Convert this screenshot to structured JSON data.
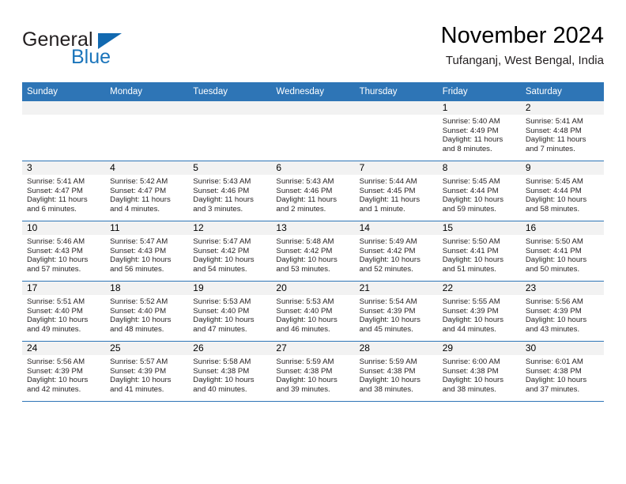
{
  "brand": {
    "name_part1": "General",
    "name_part2": "Blue"
  },
  "header": {
    "title": "November 2024",
    "subtitle": "Tufanganj, West Bengal, India"
  },
  "colors": {
    "header_blue": "#2e75b6",
    "brand_blue": "#1b75bb",
    "day_band_gray": "#f2f2f2"
  },
  "weekday_headers": [
    "Sunday",
    "Monday",
    "Tuesday",
    "Wednesday",
    "Thursday",
    "Friday",
    "Saturday"
  ],
  "weeks": [
    [
      {
        "day": "",
        "sunrise": "",
        "sunset": "",
        "daylight_line1": "",
        "daylight_line2": ""
      },
      {
        "day": "",
        "sunrise": "",
        "sunset": "",
        "daylight_line1": "",
        "daylight_line2": ""
      },
      {
        "day": "",
        "sunrise": "",
        "sunset": "",
        "daylight_line1": "",
        "daylight_line2": ""
      },
      {
        "day": "",
        "sunrise": "",
        "sunset": "",
        "daylight_line1": "",
        "daylight_line2": ""
      },
      {
        "day": "",
        "sunrise": "",
        "sunset": "",
        "daylight_line1": "",
        "daylight_line2": ""
      },
      {
        "day": "1",
        "sunrise": "Sunrise: 5:40 AM",
        "sunset": "Sunset: 4:49 PM",
        "daylight_line1": "Daylight: 11 hours",
        "daylight_line2": "and 8 minutes."
      },
      {
        "day": "2",
        "sunrise": "Sunrise: 5:41 AM",
        "sunset": "Sunset: 4:48 PM",
        "daylight_line1": "Daylight: 11 hours",
        "daylight_line2": "and 7 minutes."
      }
    ],
    [
      {
        "day": "3",
        "sunrise": "Sunrise: 5:41 AM",
        "sunset": "Sunset: 4:47 PM",
        "daylight_line1": "Daylight: 11 hours",
        "daylight_line2": "and 6 minutes."
      },
      {
        "day": "4",
        "sunrise": "Sunrise: 5:42 AM",
        "sunset": "Sunset: 4:47 PM",
        "daylight_line1": "Daylight: 11 hours",
        "daylight_line2": "and 4 minutes."
      },
      {
        "day": "5",
        "sunrise": "Sunrise: 5:43 AM",
        "sunset": "Sunset: 4:46 PM",
        "daylight_line1": "Daylight: 11 hours",
        "daylight_line2": "and 3 minutes."
      },
      {
        "day": "6",
        "sunrise": "Sunrise: 5:43 AM",
        "sunset": "Sunset: 4:46 PM",
        "daylight_line1": "Daylight: 11 hours",
        "daylight_line2": "and 2 minutes."
      },
      {
        "day": "7",
        "sunrise": "Sunrise: 5:44 AM",
        "sunset": "Sunset: 4:45 PM",
        "daylight_line1": "Daylight: 11 hours",
        "daylight_line2": "and 1 minute."
      },
      {
        "day": "8",
        "sunrise": "Sunrise: 5:45 AM",
        "sunset": "Sunset: 4:44 PM",
        "daylight_line1": "Daylight: 10 hours",
        "daylight_line2": "and 59 minutes."
      },
      {
        "day": "9",
        "sunrise": "Sunrise: 5:45 AM",
        "sunset": "Sunset: 4:44 PM",
        "daylight_line1": "Daylight: 10 hours",
        "daylight_line2": "and 58 minutes."
      }
    ],
    [
      {
        "day": "10",
        "sunrise": "Sunrise: 5:46 AM",
        "sunset": "Sunset: 4:43 PM",
        "daylight_line1": "Daylight: 10 hours",
        "daylight_line2": "and 57 minutes."
      },
      {
        "day": "11",
        "sunrise": "Sunrise: 5:47 AM",
        "sunset": "Sunset: 4:43 PM",
        "daylight_line1": "Daylight: 10 hours",
        "daylight_line2": "and 56 minutes."
      },
      {
        "day": "12",
        "sunrise": "Sunrise: 5:47 AM",
        "sunset": "Sunset: 4:42 PM",
        "daylight_line1": "Daylight: 10 hours",
        "daylight_line2": "and 54 minutes."
      },
      {
        "day": "13",
        "sunrise": "Sunrise: 5:48 AM",
        "sunset": "Sunset: 4:42 PM",
        "daylight_line1": "Daylight: 10 hours",
        "daylight_line2": "and 53 minutes."
      },
      {
        "day": "14",
        "sunrise": "Sunrise: 5:49 AM",
        "sunset": "Sunset: 4:42 PM",
        "daylight_line1": "Daylight: 10 hours",
        "daylight_line2": "and 52 minutes."
      },
      {
        "day": "15",
        "sunrise": "Sunrise: 5:50 AM",
        "sunset": "Sunset: 4:41 PM",
        "daylight_line1": "Daylight: 10 hours",
        "daylight_line2": "and 51 minutes."
      },
      {
        "day": "16",
        "sunrise": "Sunrise: 5:50 AM",
        "sunset": "Sunset: 4:41 PM",
        "daylight_line1": "Daylight: 10 hours",
        "daylight_line2": "and 50 minutes."
      }
    ],
    [
      {
        "day": "17",
        "sunrise": "Sunrise: 5:51 AM",
        "sunset": "Sunset: 4:40 PM",
        "daylight_line1": "Daylight: 10 hours",
        "daylight_line2": "and 49 minutes."
      },
      {
        "day": "18",
        "sunrise": "Sunrise: 5:52 AM",
        "sunset": "Sunset: 4:40 PM",
        "daylight_line1": "Daylight: 10 hours",
        "daylight_line2": "and 48 minutes."
      },
      {
        "day": "19",
        "sunrise": "Sunrise: 5:53 AM",
        "sunset": "Sunset: 4:40 PM",
        "daylight_line1": "Daylight: 10 hours",
        "daylight_line2": "and 47 minutes."
      },
      {
        "day": "20",
        "sunrise": "Sunrise: 5:53 AM",
        "sunset": "Sunset: 4:40 PM",
        "daylight_line1": "Daylight: 10 hours",
        "daylight_line2": "and 46 minutes."
      },
      {
        "day": "21",
        "sunrise": "Sunrise: 5:54 AM",
        "sunset": "Sunset: 4:39 PM",
        "daylight_line1": "Daylight: 10 hours",
        "daylight_line2": "and 45 minutes."
      },
      {
        "day": "22",
        "sunrise": "Sunrise: 5:55 AM",
        "sunset": "Sunset: 4:39 PM",
        "daylight_line1": "Daylight: 10 hours",
        "daylight_line2": "and 44 minutes."
      },
      {
        "day": "23",
        "sunrise": "Sunrise: 5:56 AM",
        "sunset": "Sunset: 4:39 PM",
        "daylight_line1": "Daylight: 10 hours",
        "daylight_line2": "and 43 minutes."
      }
    ],
    [
      {
        "day": "24",
        "sunrise": "Sunrise: 5:56 AM",
        "sunset": "Sunset: 4:39 PM",
        "daylight_line1": "Daylight: 10 hours",
        "daylight_line2": "and 42 minutes."
      },
      {
        "day": "25",
        "sunrise": "Sunrise: 5:57 AM",
        "sunset": "Sunset: 4:39 PM",
        "daylight_line1": "Daylight: 10 hours",
        "daylight_line2": "and 41 minutes."
      },
      {
        "day": "26",
        "sunrise": "Sunrise: 5:58 AM",
        "sunset": "Sunset: 4:38 PM",
        "daylight_line1": "Daylight: 10 hours",
        "daylight_line2": "and 40 minutes."
      },
      {
        "day": "27",
        "sunrise": "Sunrise: 5:59 AM",
        "sunset": "Sunset: 4:38 PM",
        "daylight_line1": "Daylight: 10 hours",
        "daylight_line2": "and 39 minutes."
      },
      {
        "day": "28",
        "sunrise": "Sunrise: 5:59 AM",
        "sunset": "Sunset: 4:38 PM",
        "daylight_line1": "Daylight: 10 hours",
        "daylight_line2": "and 38 minutes."
      },
      {
        "day": "29",
        "sunrise": "Sunrise: 6:00 AM",
        "sunset": "Sunset: 4:38 PM",
        "daylight_line1": "Daylight: 10 hours",
        "daylight_line2": "and 38 minutes."
      },
      {
        "day": "30",
        "sunrise": "Sunrise: 6:01 AM",
        "sunset": "Sunset: 4:38 PM",
        "daylight_line1": "Daylight: 10 hours",
        "daylight_line2": "and 37 minutes."
      }
    ]
  ]
}
